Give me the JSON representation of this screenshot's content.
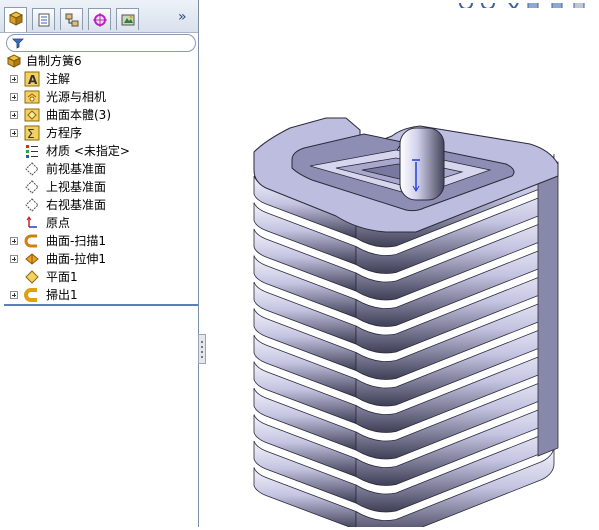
{
  "feature_tree": {
    "root_label": "自制方簧6",
    "items": [
      {
        "label": "注解",
        "icon": "annotation-icon",
        "expandable": true
      },
      {
        "label": "光源与相机",
        "icon": "lights-cameras-icon",
        "expandable": true
      },
      {
        "label": "曲面本體(3)",
        "icon": "surface-bodies-icon",
        "expandable": true
      },
      {
        "label": "方程序",
        "icon": "equations-icon",
        "expandable": true
      },
      {
        "label": "材质 <未指定>",
        "icon": "material-icon",
        "expandable": false
      },
      {
        "label": "前视基准面",
        "icon": "plane-icon",
        "expandable": false
      },
      {
        "label": "上视基准面",
        "icon": "plane-icon",
        "expandable": false
      },
      {
        "label": "右视基准面",
        "icon": "plane-icon",
        "expandable": false
      },
      {
        "label": "原点",
        "icon": "origin-icon",
        "expandable": false
      },
      {
        "label": "曲面-扫描1",
        "icon": "surface-sweep-icon",
        "expandable": true
      },
      {
        "label": "曲面-拉伸1",
        "icon": "surface-extrude-icon",
        "expandable": true
      },
      {
        "label": "平面1",
        "icon": "planar-surface-icon",
        "expandable": false
      },
      {
        "label": "掃出1",
        "icon": "sweep-icon",
        "expandable": true
      }
    ]
  },
  "tabs": [
    {
      "name": "featuremanager-tab"
    },
    {
      "name": "propertymanager-tab"
    },
    {
      "name": "configurationmanager-tab"
    },
    {
      "name": "dimxpert-tab"
    },
    {
      "name": "display-manager-tab"
    }
  ],
  "colors": {
    "panel_bg": "#ffffff",
    "toolbar_bg": "#dde4ee",
    "spring_face": "#b8b8dc",
    "spring_dark": "#4e4e66",
    "spring_light": "#f6f6fc"
  }
}
